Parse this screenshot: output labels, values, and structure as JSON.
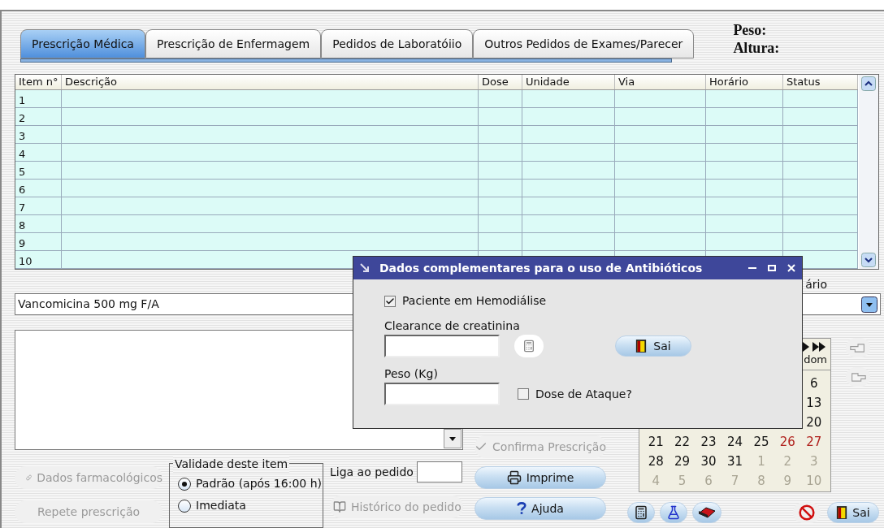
{
  "tabs": [
    {
      "label": "Prescrição Médica",
      "selected": true
    },
    {
      "label": "Prescrição de Enfermagem",
      "selected": false
    },
    {
      "label": "Pedidos de Laboratóiio",
      "selected": false
    },
    {
      "label": "Outros Pedidos de Exames/Parecer",
      "selected": false
    }
  ],
  "patient": {
    "weight_label": "Peso:",
    "height_label": "Altura:"
  },
  "table": {
    "columns": [
      "Item n°",
      "Descrição",
      "Dose",
      "Unidade",
      "Via",
      "Horário",
      "Status"
    ],
    "rows": [
      {
        "item": "1"
      },
      {
        "item": "2"
      },
      {
        "item": "3"
      },
      {
        "item": "4"
      },
      {
        "item": "5"
      },
      {
        "item": "6"
      },
      {
        "item": "7"
      },
      {
        "item": "8"
      },
      {
        "item": "9"
      },
      {
        "item": "10"
      }
    ]
  },
  "schedule_label": "ário",
  "medication_field": {
    "value": "Vancomicina 500 mg F/A"
  },
  "left_buttons": [
    {
      "label": "Dados farmacológicos",
      "disabled": true,
      "kind": "pill"
    },
    {
      "label": "Repete prescrição",
      "disabled": true
    }
  ],
  "validity": {
    "title": "Validade deste item",
    "options": [
      {
        "label": "Padrão (após 16:00 h)",
        "selected": true
      },
      {
        "label": "Imediata",
        "selected": false
      }
    ]
  },
  "link_order": {
    "label": "Liga ao pedido"
  },
  "history_button": {
    "label": "Histórico do pedido",
    "disabled": true
  },
  "action_buttons": [
    {
      "label": "Confirma Prescrição",
      "disabled": true,
      "kind": "check"
    },
    {
      "label": "Imprime",
      "disabled": false,
      "kind": "printer"
    },
    {
      "label": "Ajuda",
      "disabled": false,
      "kind": "help"
    }
  ],
  "calendar": {
    "header": "dom",
    "weeks": [
      {
        "days": [
          {
            "day": "6",
            "kind": "current"
          }
        ]
      },
      {
        "days": [
          {
            "day": "13",
            "kind": "current"
          }
        ]
      },
      {
        "days": [
          {
            "day": "20",
            "kind": "current"
          }
        ]
      },
      {
        "days": [
          {
            "day": "21",
            "kind": "current"
          },
          {
            "day": "22",
            "kind": "current"
          },
          {
            "day": "23",
            "kind": "current"
          },
          {
            "day": "24",
            "kind": "current"
          },
          {
            "day": "25",
            "kind": "current"
          },
          {
            "day": "26",
            "kind": "weekend"
          },
          {
            "day": "27",
            "kind": "weekend"
          }
        ]
      },
      {
        "days": [
          {
            "day": "28",
            "kind": "current"
          },
          {
            "day": "29",
            "kind": "current"
          },
          {
            "day": "30",
            "kind": "current"
          },
          {
            "day": "31",
            "kind": "current"
          },
          {
            "day": "1",
            "kind": "other"
          },
          {
            "day": "2",
            "kind": "other"
          },
          {
            "day": "3",
            "kind": "other"
          }
        ]
      },
      {
        "days": [
          {
            "day": "4",
            "kind": "other"
          },
          {
            "day": "5",
            "kind": "other"
          },
          {
            "day": "6",
            "kind": "other"
          },
          {
            "day": "7",
            "kind": "other"
          },
          {
            "day": "8",
            "kind": "other"
          },
          {
            "day": "9",
            "kind": "other"
          },
          {
            "day": "10",
            "kind": "other"
          }
        ]
      }
    ]
  },
  "exit_button": {
    "label": "Sai"
  },
  "dialog": {
    "title": "Dados complementares para o uso de Antibióticos",
    "hemodialysis": {
      "label": "Paciente em Hemodiálise",
      "checked": true
    },
    "clearance": {
      "label": "Clearance de creatinina"
    },
    "weight": {
      "label": "Peso (Kg)"
    },
    "loading_dose": {
      "label": "Dose de Ataque?",
      "checked": false
    },
    "exit_button": {
      "label": "Sai"
    }
  }
}
